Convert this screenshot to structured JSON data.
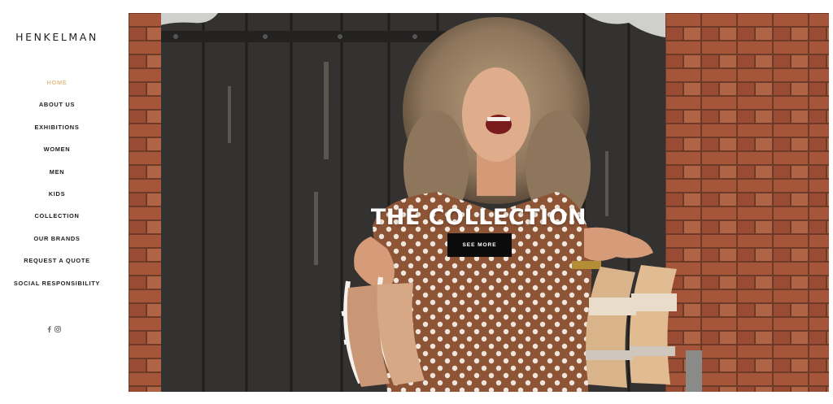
{
  "brand": {
    "name": "HENKELMAN"
  },
  "nav": {
    "items": [
      {
        "label": "HOME",
        "active": true
      },
      {
        "label": "ABOUT US",
        "active": false
      },
      {
        "label": "EXHIBITIONS",
        "active": false
      },
      {
        "label": "WOMEN",
        "active": false
      },
      {
        "label": "MEN",
        "active": false
      },
      {
        "label": "KIDS",
        "active": false
      },
      {
        "label": "COLLECTION",
        "active": false
      },
      {
        "label": "OUR BRANDS",
        "active": false
      },
      {
        "label": "REQUEST A QUOTE",
        "active": false
      },
      {
        "label": "SOCIAL RESPONSIBILITY",
        "active": false
      }
    ]
  },
  "social": {
    "icons": [
      "facebook-icon",
      "instagram-icon"
    ]
  },
  "hero": {
    "title": "THE COLLECTION",
    "cta_label": "SEE MORE"
  },
  "colors": {
    "active_nav": "#e2c08f",
    "cta_bg": "#0b0b0b",
    "text": "#1c1c1c"
  }
}
